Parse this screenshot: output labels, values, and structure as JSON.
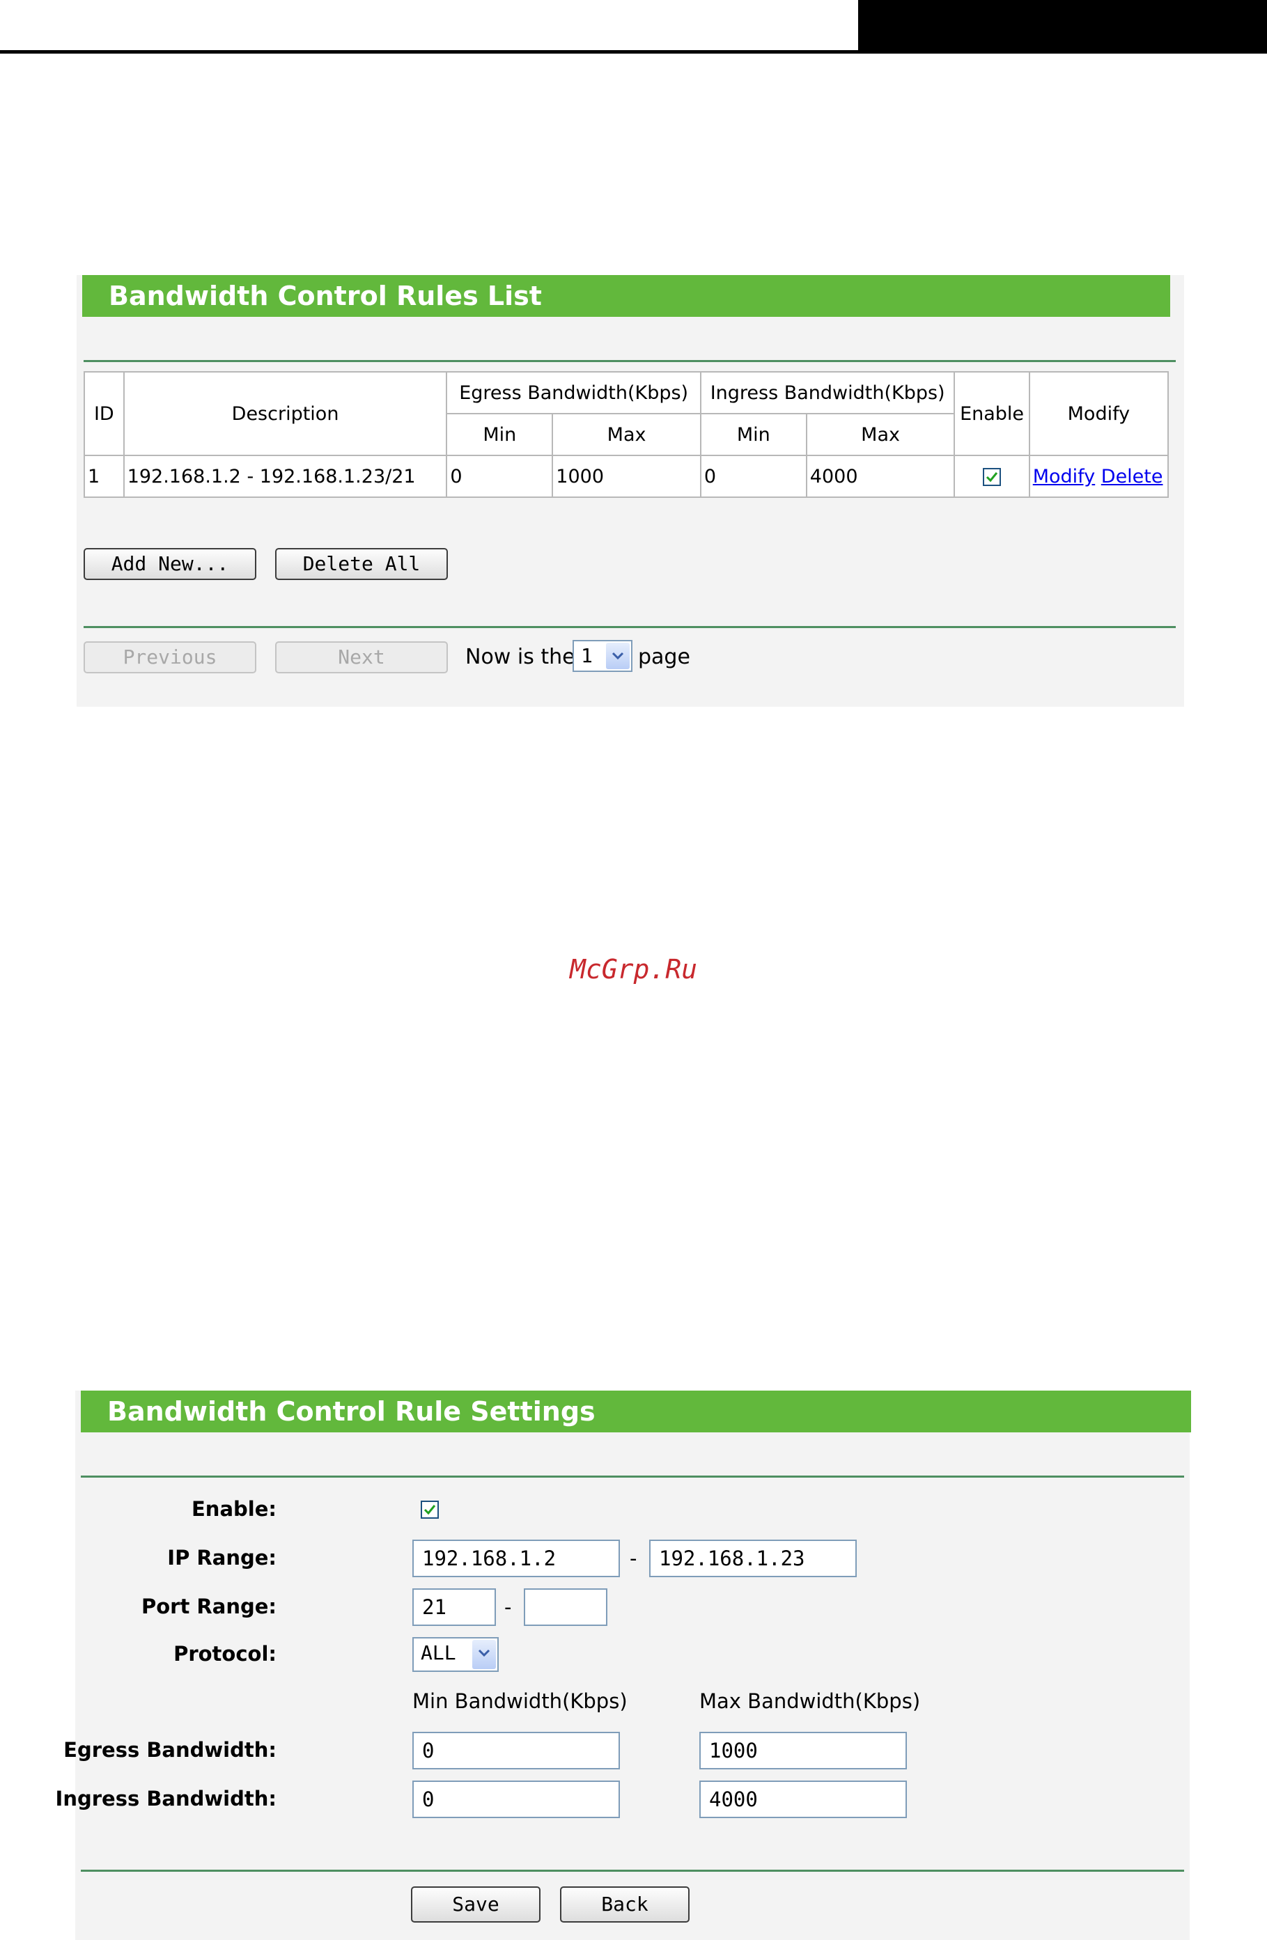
{
  "rules_list": {
    "title": "Bandwidth Control Rules List",
    "headers": {
      "id": "ID",
      "description": "Description",
      "egress": "Egress Bandwidth(Kbps)",
      "ingress": "Ingress Bandwidth(Kbps)",
      "enable": "Enable",
      "modify": "Modify",
      "min": "Min",
      "max": "Max"
    },
    "rows": [
      {
        "id": "1",
        "description": "192.168.1.2 - 192.168.1.23/21",
        "egress_min": "0",
        "egress_max": "1000",
        "ingress_min": "0",
        "ingress_max": "4000",
        "enabled": true,
        "modify_label": "Modify",
        "delete_label": "Delete"
      }
    ],
    "buttons": {
      "add_new": "Add New...",
      "delete_all": "Delete All",
      "previous": "Previous",
      "next": "Next"
    },
    "pager": {
      "prefix": "Now is the",
      "current_page": "1",
      "suffix": "page"
    }
  },
  "watermark": "McGrp.Ru",
  "rule_settings": {
    "title": "Bandwidth Control Rule Settings",
    "labels": {
      "enable": "Enable:",
      "ip_range": "IP Range:",
      "port_range": "Port Range:",
      "protocol": "Protocol:",
      "egress": "Egress Bandwidth:",
      "ingress": "Ingress Bandwidth:",
      "min_col": "Min Bandwidth(Kbps)",
      "max_col": "Max Bandwidth(Kbps)"
    },
    "values": {
      "enabled": true,
      "ip_start": "192.168.1.2",
      "ip_end": "192.168.1.23",
      "port_start": "21",
      "port_end": "",
      "protocol": "ALL",
      "egress_min": "0",
      "egress_max": "1000",
      "ingress_min": "0",
      "ingress_max": "4000"
    },
    "separator": "-",
    "buttons": {
      "save": "Save",
      "back": "Back"
    }
  },
  "colors": {
    "header_green": "#62b83c",
    "divider_green": "#4e8f61",
    "link_blue": "#0000ee"
  }
}
